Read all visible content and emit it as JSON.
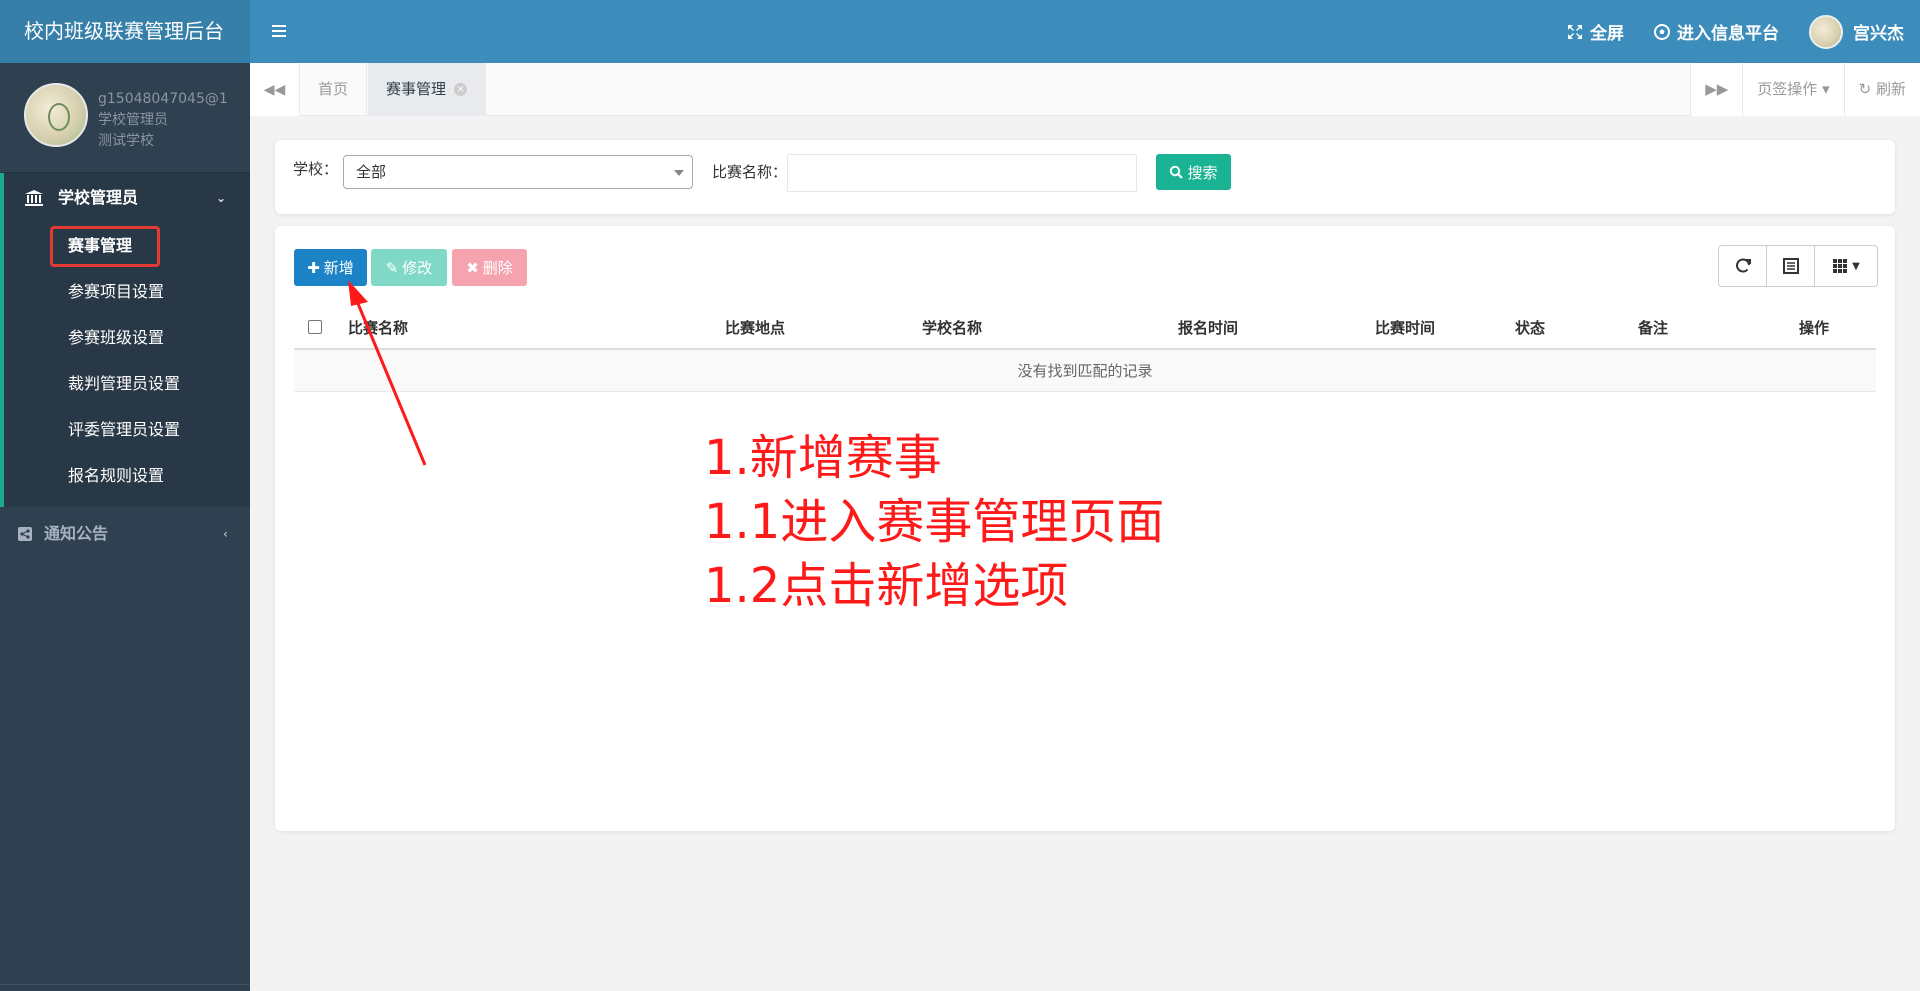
{
  "app": {
    "title": "校内班级联赛管理后台"
  },
  "header": {
    "fullscreen_label": "全屏",
    "info_platform_label": "进入信息平台",
    "username": "宫兴杰"
  },
  "profile": {
    "email": "g15048047045@1",
    "role": "学校管理员",
    "school": "测试学校"
  },
  "sidebar": {
    "group1": {
      "label": "学校管理员"
    },
    "items": [
      {
        "label": "赛事管理"
      },
      {
        "label": "参赛项目设置"
      },
      {
        "label": "参赛班级设置"
      },
      {
        "label": "裁判管理员设置"
      },
      {
        "label": "评委管理员设置"
      },
      {
        "label": "报名规则设置"
      }
    ],
    "group2": {
      "label": "通知公告"
    }
  },
  "tabs": {
    "home": "首页",
    "current": "赛事管理",
    "page_ops": "页签操作",
    "refresh": "刷新"
  },
  "search": {
    "school_label": "学校：",
    "school_value": "全部",
    "name_label": "比赛名称：",
    "name_value": "",
    "button": "搜索"
  },
  "toolbar": {
    "add": "新增",
    "edit": "修改",
    "delete": "删除"
  },
  "table": {
    "columns": [
      "比赛名称",
      "比赛地点",
      "学校名称",
      "报名时间",
      "比赛时间",
      "状态",
      "备注",
      "操作"
    ],
    "empty_text": "没有找到匹配的记录"
  },
  "annotation": {
    "lines": [
      "1.新增赛事",
      "1.1进入赛事管理页面",
      "1.2点击新增选项"
    ],
    "color": "#ff1a1a"
  },
  "colors": {
    "brand": "#367fa9",
    "header": "#3c8dbc",
    "sidebar": "#2f4050",
    "primary": "#1c84c6",
    "success": "#1ab394"
  }
}
